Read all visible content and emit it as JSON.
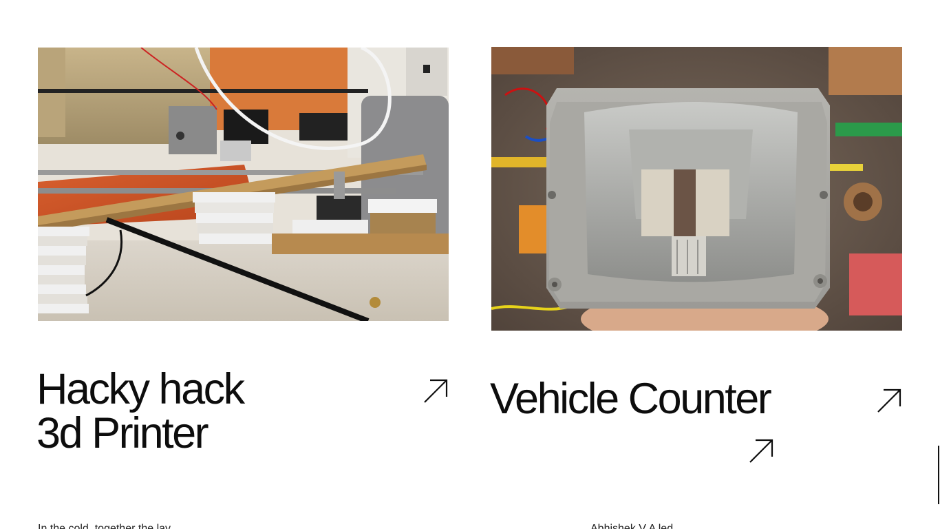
{
  "projects": [
    {
      "title_line1": "Hacky hack",
      "title_line2": "3d Printer",
      "image_alt": "Homemade 3D printer frame with stepper motors and rods",
      "description": "In the cold, together the lay"
    },
    {
      "title_line1": "Vehicle Counter",
      "image_alt": "Camera module inside grey light enclosure held in hand",
      "description": "Abhishek V A led"
    }
  ],
  "icons": {
    "arrow": "arrow-up-right-icon"
  },
  "colors": {
    "text": "#0d0d0d",
    "background": "#ffffff"
  }
}
